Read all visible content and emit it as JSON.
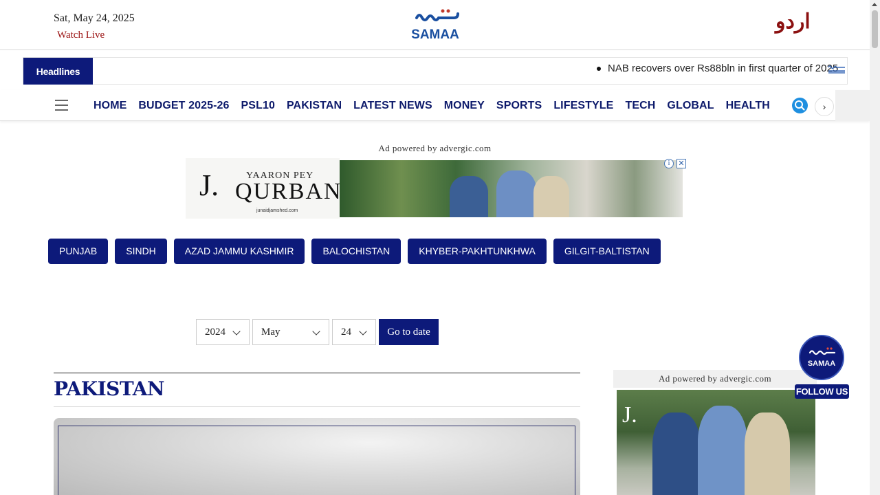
{
  "header": {
    "date": "Sat, May 24, 2025",
    "watch_live": "Watch Live",
    "logo_text": "SAMAA",
    "urdu_link": "اردو"
  },
  "ticker": {
    "tag": "Headlines",
    "items": [
      "NAB recovers over Rs88bln in first quarter of 2025"
    ]
  },
  "nav": {
    "items": [
      "HOME",
      "BUDGET 2025-26",
      "PSL10",
      "PAKISTAN",
      "LATEST NEWS",
      "MONEY",
      "SPORTS",
      "LIFESTYLE",
      "TECH",
      "GLOBAL",
      "HEALTH"
    ],
    "next_glyph": "›"
  },
  "ads": {
    "top_label": "Ad powered by advergic.com",
    "top_brand_mark": "J.",
    "top_headline_small": "YAARON PEY",
    "top_headline_big": "QURBAN",
    "top_site": "junaidjamshed.com",
    "close_glyph": "✕",
    "info_glyph": "i",
    "side_label": "Ad powered by advergic.com",
    "side_brand_mark": "J."
  },
  "provinces": [
    "PUNJAB",
    "SINDH",
    "AZAD JAMMU KASHMIR",
    "BALOCHISTAN",
    "KHYBER-PAKHTUNKHWA",
    "GILGIT-BALTISTAN"
  ],
  "date_picker": {
    "year": "2024",
    "month": "May",
    "day": "24",
    "go_label": "Go to date"
  },
  "section": {
    "title": "PAKISTAN"
  },
  "follow": {
    "logo_text": "SAMAA",
    "label": "FOLLOW US"
  },
  "colors": {
    "brand_navy": "#0d1a7a",
    "watch_red": "#9b1212",
    "search_blue": "#1e8fe0"
  }
}
